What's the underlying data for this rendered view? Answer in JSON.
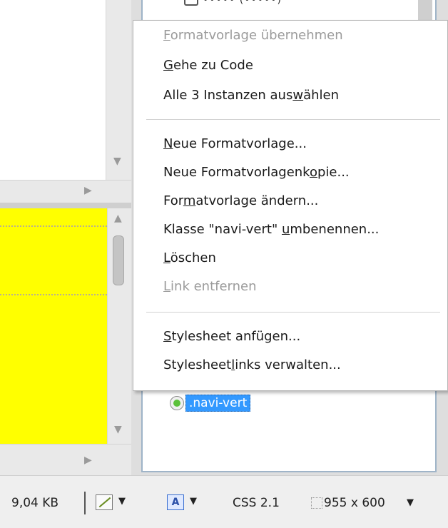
{
  "context_menu": {
    "items": [
      {
        "label": "Formatvorlage übernehmen",
        "mnemonic_index": 0,
        "disabled": true
      },
      {
        "label": "Gehe zu Code",
        "mnemonic_index": 0,
        "disabled": false
      },
      {
        "label": "Alle 3 Instanzen auswählen",
        "mnemonic_index": 20,
        "disabled": false
      },
      {
        "separator": true
      },
      {
        "label": "Neue Formatvorlage...",
        "mnemonic_index": 0,
        "disabled": false
      },
      {
        "label": "Neue Formatvorlagenkopie...",
        "mnemonic_index": 20,
        "disabled": false
      },
      {
        "label": "Formatvorlage ändern...",
        "mnemonic_index": 3,
        "disabled": false
      },
      {
        "label": "Klasse \"navi-vert\" umbenennen...",
        "mnemonic_index": 19,
        "disabled": false
      },
      {
        "label": "Löschen",
        "mnemonic_index": 0,
        "disabled": false
      },
      {
        "label": "Link entfernen",
        "mnemonic_index": 0,
        "disabled": true
      },
      {
        "separator": true
      },
      {
        "label": "Stylesheet anfügen...",
        "mnemonic_index": 0,
        "disabled": false
      },
      {
        "label": "Stylesheetlinks verwalten...",
        "mnemonic_index": 10,
        "disabled": false
      }
    ]
  },
  "style_list": {
    "selected_item": ".navi-vert",
    "top_item_text": "••••• (•••••)"
  },
  "status_bar": {
    "file_size": "9,04 KB",
    "css_version": "CSS 2.1",
    "dimensions": "955 x 600"
  },
  "colors": {
    "canvas_highlight": "#ffff00",
    "selection": "#3399ff",
    "disabled_text": "#9b9b9b"
  },
  "icons": {
    "tool1": "draw-tool-icon",
    "tool2": "text-format-icon",
    "style_item": "style-radio-icon"
  }
}
